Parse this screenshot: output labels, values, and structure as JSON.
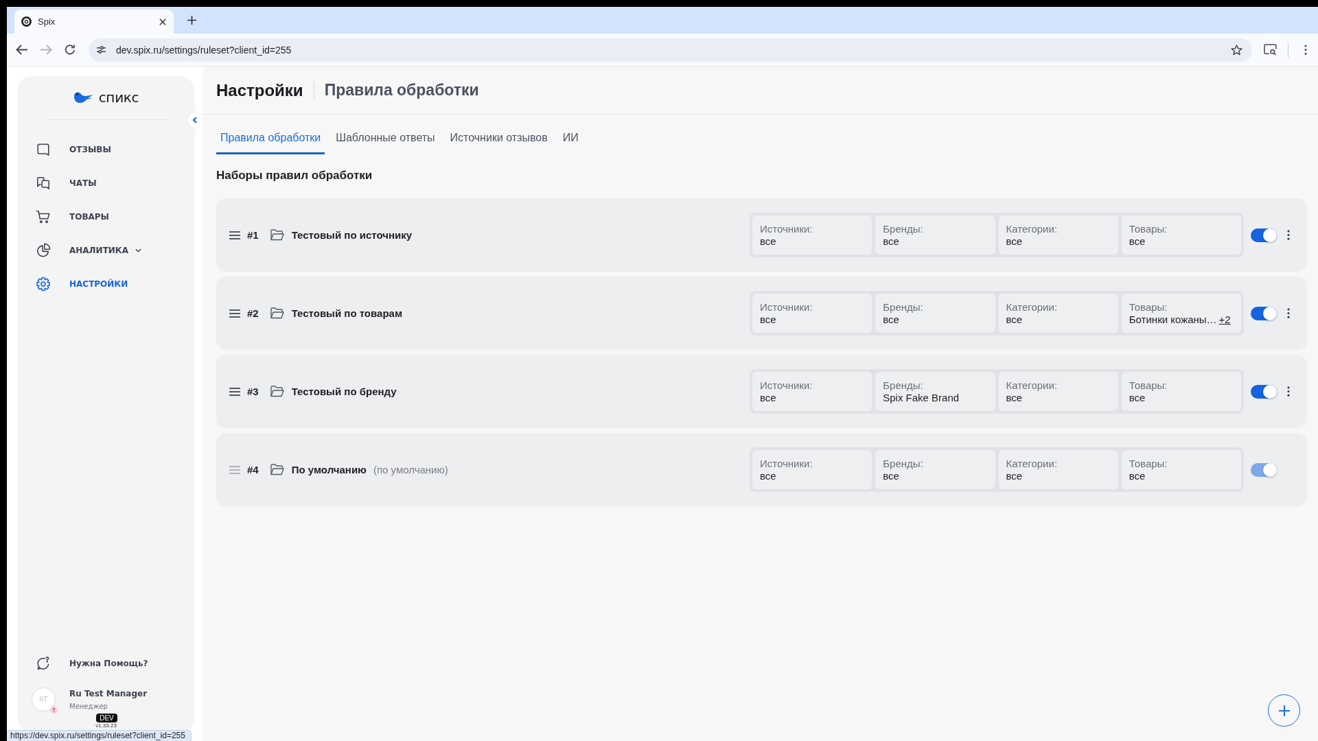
{
  "browser": {
    "tabs": [
      {
        "title": "Spix",
        "selected": true
      }
    ],
    "nav_buttons": [
      {
        "kind": "back",
        "disabled": false
      },
      {
        "kind": "forward",
        "disabled": true
      },
      {
        "kind": "reload",
        "disabled": false
      }
    ],
    "url": "dev.spix.ru/settings/ruleset?client_id=255",
    "status_url": "https://dev.spix.ru/settings/ruleset?client_id=255"
  },
  "sidebar": {
    "logo": "спикс",
    "items": [
      {
        "label": "ОТЗЫВЫ",
        "kind": "link",
        "selected": false
      },
      {
        "label": "ЧАТЫ",
        "kind": "link",
        "selected": false
      },
      {
        "label": "ТОВАРЫ",
        "kind": "link",
        "selected": false
      },
      {
        "label": "АНАЛИТИКА",
        "kind": "group",
        "selected": false
      },
      {
        "label": "НАСТРОЙКИ",
        "kind": "link",
        "selected": true
      }
    ],
    "help": "Нужна Помощь?",
    "user": {
      "initials": "RT",
      "name": "Ru Test Manager",
      "role": "Менеджер",
      "alert": true
    },
    "env_badge": "DEV",
    "version": "v1.33.23"
  },
  "header": {
    "title": "Настройки",
    "subtitle": "Правила обработки"
  },
  "tabs": [
    {
      "label": "Правила обработки",
      "selected": true
    },
    {
      "label": "Шаблонные ответы",
      "selected": false
    },
    {
      "label": "Источники отзывов",
      "selected": false
    },
    {
      "label": "ИИ",
      "selected": false
    }
  ],
  "section_title": "Наборы правил обработки",
  "rulesets": [
    {
      "number": "#1",
      "name": "Тестовый по источнику",
      "filters": [
        {
          "label": "Источники:",
          "value": "все"
        },
        {
          "label": "Бренды:",
          "value": "все"
        },
        {
          "label": "Категории:",
          "value": "все"
        },
        {
          "label": "Товары:",
          "value": "все"
        }
      ],
      "on": true,
      "disabled": false
    },
    {
      "number": "#2",
      "name": "Тестовый по товарам",
      "filters": [
        {
          "label": "Источники:",
          "value": "все"
        },
        {
          "label": "Бренды:",
          "value": "все"
        },
        {
          "label": "Категории:",
          "value": "все"
        },
        {
          "label": "Товары:",
          "value": "Ботинки кожаны…",
          "more": "+2"
        }
      ],
      "on": true,
      "disabled": false
    },
    {
      "number": "#3",
      "name": "Тестовый по бренду",
      "filters": [
        {
          "label": "Источники:",
          "value": "все"
        },
        {
          "label": "Бренды:",
          "value": "Spix Fake Brand"
        },
        {
          "label": "Категории:",
          "value": "все"
        },
        {
          "label": "Товары:",
          "value": "все"
        }
      ],
      "on": true,
      "disabled": false
    },
    {
      "number": "#4",
      "name": "По умолчанию",
      "note": "(по умолчанию)",
      "filters": [
        {
          "label": "Источники:",
          "value": "все"
        },
        {
          "label": "Бренды:",
          "value": "все"
        },
        {
          "label": "Категории:",
          "value": "все"
        },
        {
          "label": "Товары:",
          "value": "все"
        }
      ],
      "on": true,
      "disabled": true
    }
  ]
}
